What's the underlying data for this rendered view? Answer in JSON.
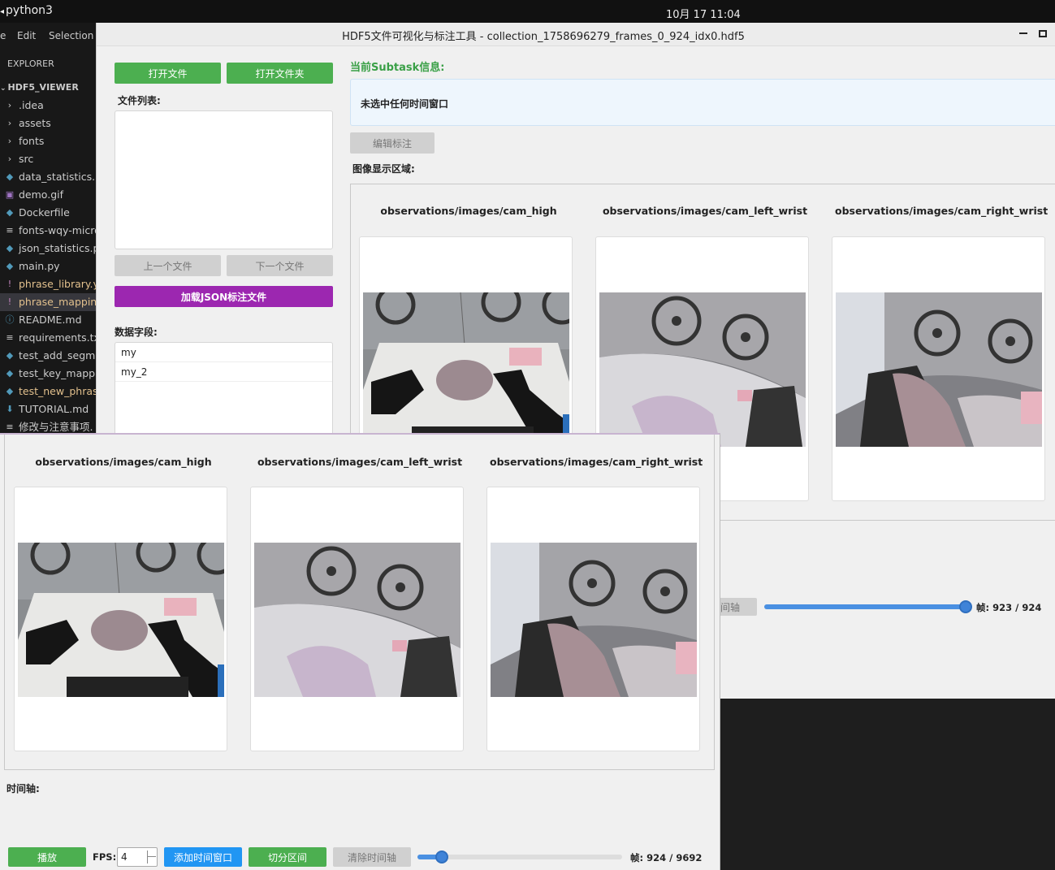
{
  "system": {
    "app_name": "python3",
    "clock": "10月 17  11:04"
  },
  "vscode": {
    "menu": [
      "e",
      "Edit",
      "Selection"
    ],
    "explorer_label": "EXPLORER",
    "project": "HDF5_VIEWER",
    "files": [
      {
        "label": ".idea",
        "icon": "chevron-right-icon",
        "glyph": "›"
      },
      {
        "label": "assets",
        "icon": "chevron-right-icon",
        "glyph": "›"
      },
      {
        "label": "fonts",
        "icon": "chevron-right-icon",
        "glyph": "›"
      },
      {
        "label": "src",
        "icon": "chevron-right-icon",
        "glyph": "›"
      },
      {
        "label": "data_statistics.p",
        "icon": "python-icon",
        "glyph": "◆"
      },
      {
        "label": "demo.gif",
        "icon": "image-icon",
        "glyph": "▣"
      },
      {
        "label": "Dockerfile",
        "icon": "docker-icon",
        "glyph": "◆"
      },
      {
        "label": "fonts-wqy-micro",
        "icon": "text-file-icon",
        "glyph": "≡"
      },
      {
        "label": "json_statistics.p",
        "icon": "python-icon",
        "glyph": "◆"
      },
      {
        "label": "main.py",
        "icon": "python-icon",
        "glyph": "◆"
      },
      {
        "label": "phrase_library.y",
        "icon": "yaml-icon",
        "glyph": "!"
      },
      {
        "label": "phrase_mapping",
        "icon": "yaml-icon",
        "glyph": "!"
      },
      {
        "label": "README.md",
        "icon": "info-icon",
        "glyph": "ⓘ"
      },
      {
        "label": "requirements.tx",
        "icon": "text-file-icon",
        "glyph": "≡"
      },
      {
        "label": "test_add_segme",
        "icon": "python-icon",
        "glyph": "◆"
      },
      {
        "label": "test_key_mappi",
        "icon": "python-icon",
        "glyph": "◆"
      },
      {
        "label": "test_new_phras",
        "icon": "python-icon",
        "glyph": "◆"
      },
      {
        "label": "TUTORIAL.md",
        "icon": "download-icon",
        "glyph": "⬇"
      },
      {
        "label": "修改与注意事项.",
        "icon": "text-file-icon",
        "glyph": "≡"
      }
    ]
  },
  "window": {
    "title": "HDF5文件可视化与标注工具 - collection_1758696279_frames_0_924_idx0.hdf5",
    "open_file": "打开文件",
    "open_folder": "打开文件夹",
    "file_list_label": "文件列表:",
    "prev_file": "上一个文件",
    "next_file": "下一个文件",
    "load_json": "加载JSON标注文件",
    "data_fields_label": "数据字段:",
    "data_fields": [
      "my",
      "my_2"
    ],
    "subtask_title": "当前Subtask信息:",
    "subtask_info": "未选中任何时间窗口",
    "edit_annotation": "编辑标注",
    "image_area_label": "图像显示区域:",
    "cameras": [
      "observations/images/cam_high",
      "observations/images/cam_left_wrist",
      "observations/images/cam_right_wrist"
    ],
    "timeline_btn_partial": "间轴",
    "frame_text": "帧: 923 / 924",
    "slider_fraction": 0.99
  },
  "front": {
    "cameras": [
      "observations/images/cam_high",
      "observations/images/cam_left_wrist",
      "observations/images/cam_right_wrist"
    ],
    "timeline_label": "时间轴:",
    "play": "播放",
    "fps_label": "FPS:",
    "fps_value": "4",
    "add_window": "添加时间窗口",
    "split_interval": "切分区间",
    "clear_timeline": "清除时间轴",
    "frame_text": "帧: 924 / 9692",
    "slider_fraction": 0.12
  },
  "colors": {
    "green": "#4caf50",
    "purple": "#9c27b0",
    "blue": "#2196f3",
    "subtask_green": "#3aa047"
  }
}
